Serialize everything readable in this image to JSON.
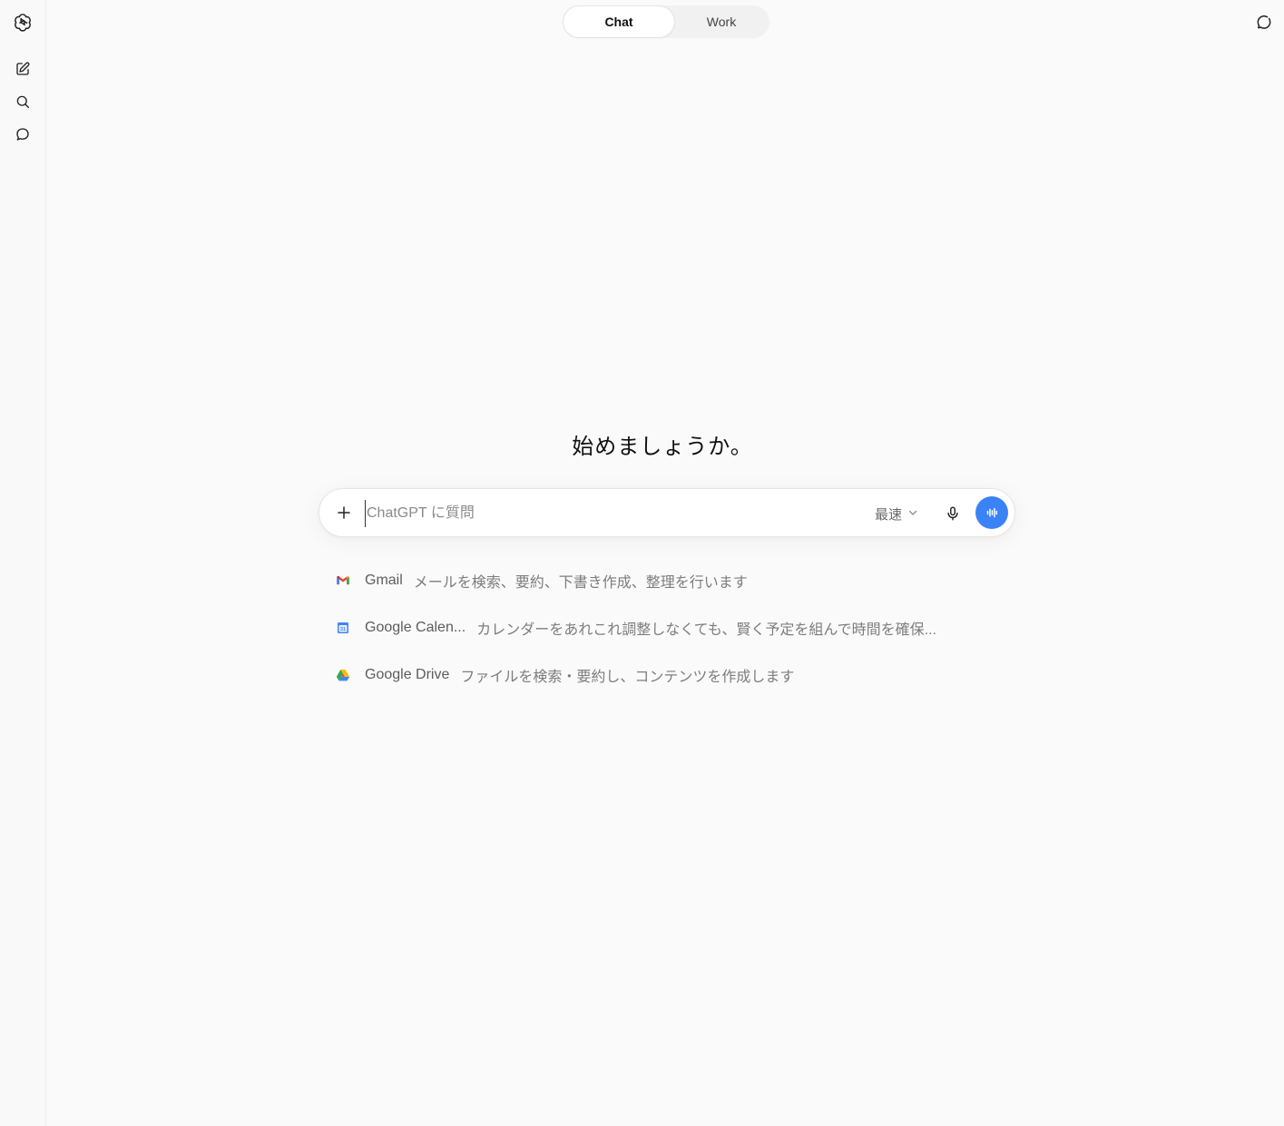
{
  "mode_toggle": {
    "chat_label": "Chat",
    "work_label": "Work",
    "active": "Chat"
  },
  "headline": "始めましょうか。",
  "composer": {
    "placeholder": "ChatGPT に質問",
    "model_label": "最速"
  },
  "suggestions": [
    {
      "name": "Gmail",
      "description": "メールを検索、要約、下書き作成、整理を行います",
      "icon": "gmail-icon"
    },
    {
      "name": "Google Calen...",
      "description": "カレンダーをあれこれ調整しなくても、賢く予定を組んで時間を確保...",
      "icon": "google-calendar-icon"
    },
    {
      "name": "Google Drive",
      "description": "ファイルを検索・要約し、コンテンツを作成します",
      "icon": "google-drive-icon"
    }
  ],
  "colors": {
    "accent": "#3b82f6",
    "background": "#fafafa"
  }
}
